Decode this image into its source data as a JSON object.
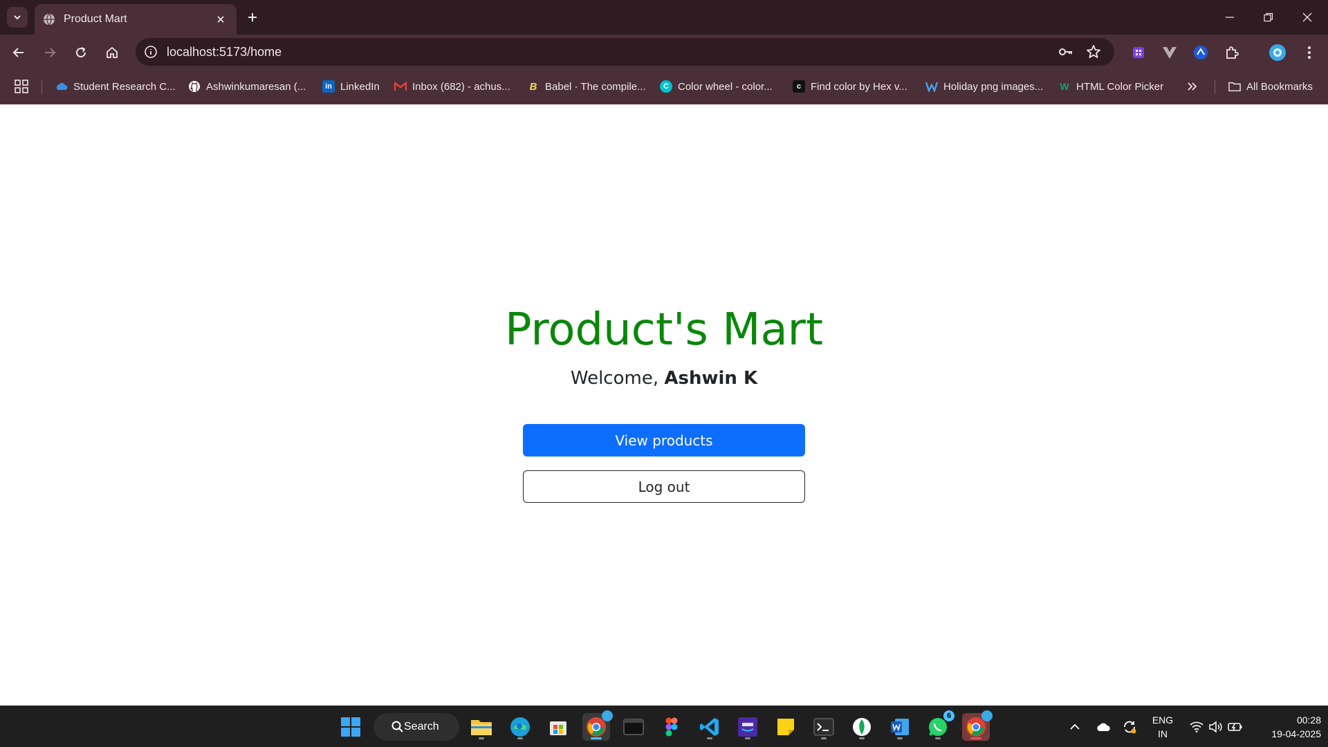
{
  "browser": {
    "tab_title": "Product Mart",
    "url": "localhost:5173/home",
    "bookmarks": [
      {
        "label": "Student Research C...",
        "icon": "onedrive-cloud-icon",
        "color": "#3a8ee6"
      },
      {
        "label": "Ashwinkumaresan (...",
        "icon": "github-icon",
        "color": "#ffffff"
      },
      {
        "label": "LinkedIn",
        "icon": "linkedin-icon",
        "color": "#0a66c2"
      },
      {
        "label": "Inbox (682) - achus...",
        "icon": "gmail-icon",
        "color": "#ea4335"
      },
      {
        "label": "Babel · The compile...",
        "icon": "babel-icon",
        "color": "#f5da55"
      },
      {
        "label": "Color wheel - color...",
        "icon": "canva-icon",
        "color": "#00c4cc"
      },
      {
        "label": "Find color by Hex v...",
        "icon": "color-hex-icon",
        "color": "#111111"
      },
      {
        "label": "Holiday png images...",
        "icon": "pngtree-icon",
        "color": "#4aa3f0"
      },
      {
        "label": "HTML Color Picker",
        "icon": "w3schools-icon",
        "color": "#04aa6d"
      }
    ],
    "all_bookmarks_label": "All Bookmarks"
  },
  "page": {
    "title": "Product's Mart",
    "welcome_prefix": "Welcome, ",
    "user_name": "Ashwin K",
    "view_products_label": "View products",
    "logout_label": "Log out",
    "title_color": "#0a870a",
    "primary_color": "#0d6efd"
  },
  "taskbar": {
    "search_label": "Search",
    "whatsapp_badge": "6",
    "lang_line1": "ENG",
    "lang_line2": "IN",
    "time": "00:28",
    "date": "19-04-2025"
  }
}
